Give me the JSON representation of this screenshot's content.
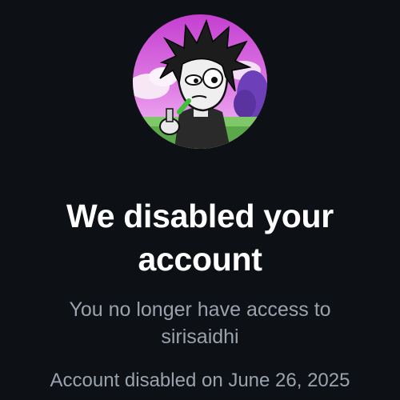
{
  "colors": {
    "background": "#0d1015",
    "headline": "#ffffff",
    "secondary_text": "#9aa3ad"
  },
  "avatar": {
    "icon": "profile-avatar-cartoon"
  },
  "headline": {
    "line1": "We disabled your",
    "line2": "account"
  },
  "message": {
    "line1": "You no longer have access to",
    "username": "sirisaidhi"
  },
  "disabled_notice": "Account disabled on June 26, 2025"
}
